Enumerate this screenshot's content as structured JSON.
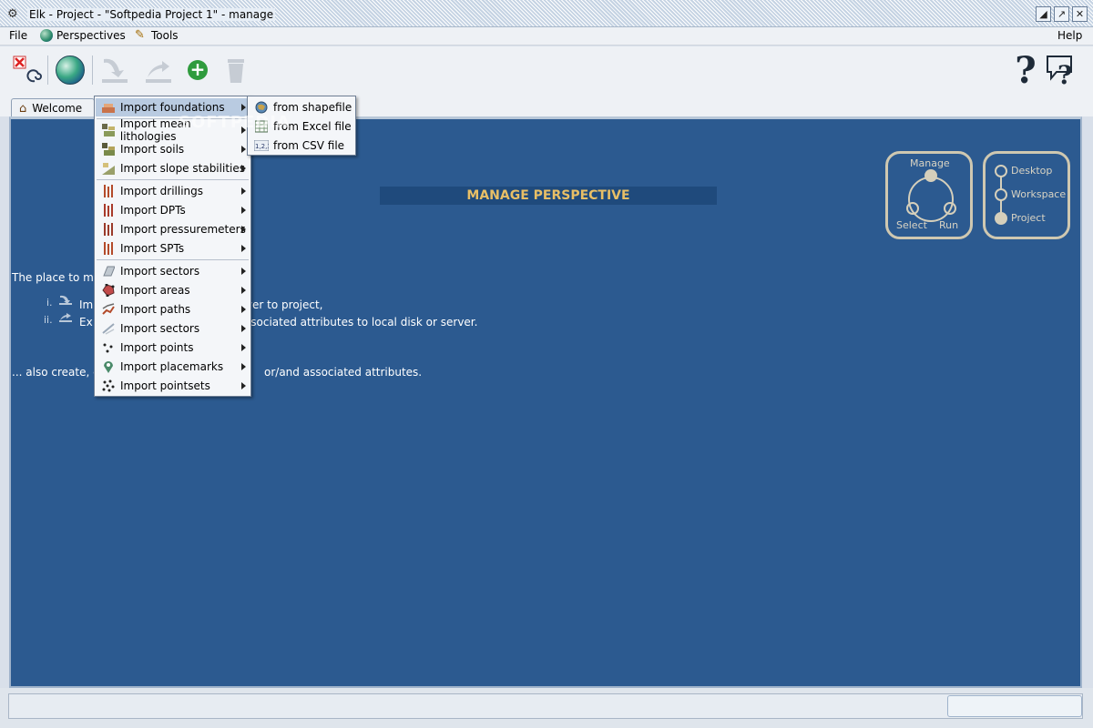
{
  "window": {
    "title": "Elk - Project - \"Softpedia Project 1\" - manage"
  },
  "menubar": {
    "file": "File",
    "perspectives": "Perspectives",
    "tools": "Tools",
    "help": "Help"
  },
  "tabs": {
    "welcome": "Welcome"
  },
  "main": {
    "banner": "MANAGE PERSPECTIVE",
    "intro": "The place to ma",
    "item1_num": "i.",
    "item1_text_a": "Im",
    "item1_text_b": "rver to project,",
    "item2_num": "ii.",
    "item2_text_a": "Ex",
    "item2_text_b": "ssociated attributes to local disk or server.",
    "also_a": "... also create, c",
    "also_b": "or/and associated attributes."
  },
  "perspective_cycle": {
    "manage": "Manage",
    "select": "Select",
    "run": "Run"
  },
  "perspective_levels": {
    "desktop": "Desktop",
    "workspace": "Workspace",
    "project": "Project"
  },
  "import_menu": [
    {
      "label": "Import foundations",
      "icon": "foundations-icon"
    },
    {
      "label": "Import mean lithologies",
      "icon": "lithologies-icon"
    },
    {
      "label": "Import soils",
      "icon": "soils-icon"
    },
    {
      "label": "Import slope stabilities",
      "icon": "slope-icon"
    },
    {
      "label": "Import drillings",
      "icon": "drilling-icon"
    },
    {
      "label": "Import DPTs",
      "icon": "dpt-icon"
    },
    {
      "label": "Import pressuremeters",
      "icon": "pressuremeter-icon"
    },
    {
      "label": "Import SPTs",
      "icon": "spt-icon"
    },
    {
      "label": "Import sectors",
      "icon": "sectors-icon"
    },
    {
      "label": "Import areas",
      "icon": "areas-icon"
    },
    {
      "label": "Import paths",
      "icon": "paths-icon"
    },
    {
      "label": "Import sectors",
      "icon": "sectors-line-icon"
    },
    {
      "label": "Import points",
      "icon": "points-icon"
    },
    {
      "label": "Import placemarks",
      "icon": "placemark-icon"
    },
    {
      "label": "Import pointsets",
      "icon": "pointsets-icon"
    }
  ],
  "submenu": [
    {
      "label": "from shapefile",
      "icon": "shapefile-icon"
    },
    {
      "label": "from Excel file",
      "icon": "excel-icon"
    },
    {
      "label": "from CSV file",
      "icon": "csv-icon"
    }
  ],
  "watermark": "SOFTPEDIA"
}
